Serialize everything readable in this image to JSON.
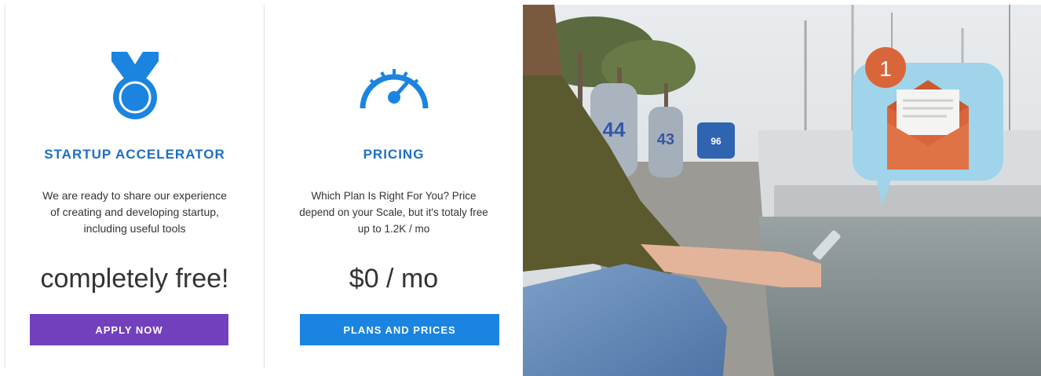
{
  "cards": [
    {
      "icon": "medal-icon",
      "title": "STARTUP ACCELERATOR",
      "description": "We are ready to share our experience of creating and developing startup, including useful tools",
      "price": "completely free!",
      "button_label": "APPLY NOW",
      "button_color": "#7240bd"
    },
    {
      "icon": "speedometer-icon",
      "title": "PRICING",
      "description": "Which Plan Is Right For You? Price depend on your Scale, but it's totaly free up to 1.2K / mo",
      "price": "$0 / mo",
      "button_label": "PLANS AND PRICES",
      "button_color": "#1a84e0"
    }
  ],
  "photo": {
    "notification_icon": "email-notification-icon",
    "notification_count": "1",
    "bollard_numbers": [
      "44",
      "43",
      "96"
    ]
  },
  "colors": {
    "title_blue": "#1c6fc3",
    "icon_blue": "#1a84e0",
    "badge_orange": "#d9663a"
  }
}
